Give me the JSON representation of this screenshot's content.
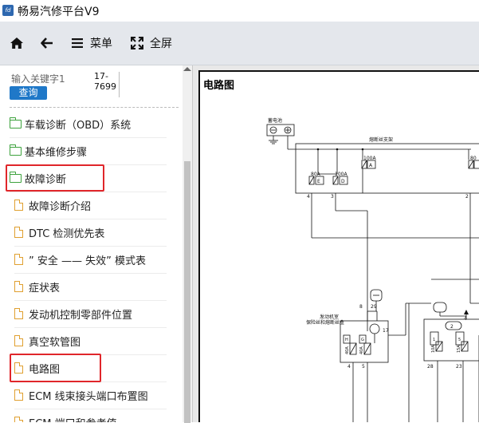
{
  "window": {
    "title": "畅易汽修平台V9",
    "logo_text": "fd"
  },
  "toolbar": {
    "home_label": "",
    "back_label": "",
    "menu_label": "菜单",
    "fullscreen_label": "全屏"
  },
  "search": {
    "placeholder": "输入关键字1",
    "button_label": "查询",
    "code": "17-7699"
  },
  "tree": [
    {
      "label": "车载诊断（OBD）系统",
      "type": "folder"
    },
    {
      "label": "基本维修步骤",
      "type": "folder"
    },
    {
      "label": "故障诊断",
      "type": "folder-open",
      "highlighted": true
    },
    {
      "label": "故障诊断介绍",
      "type": "doc"
    },
    {
      "label": "DTC 检测优先表",
      "type": "doc"
    },
    {
      "label": "” 安全 —— 失效”  模式表",
      "type": "doc"
    },
    {
      "label": "症状表",
      "type": "doc"
    },
    {
      "label": "发动机控制零部件位置",
      "type": "doc"
    },
    {
      "label": "真空软管图",
      "type": "doc"
    },
    {
      "label": "电路图",
      "type": "doc",
      "highlighted": true
    },
    {
      "label": "ECM 线束接头端口布置图",
      "type": "doc"
    },
    {
      "label": "ECM 端口和参考值",
      "type": "doc"
    }
  ],
  "document": {
    "title": "电路图",
    "diagram": {
      "battery": "蓄电池",
      "fuse_box": "熔断丝支架",
      "fuse1_rating": "100A",
      "fuse1_letter": "A",
      "fuse2_rating": "80A",
      "fuse2_letter": "E",
      "fuse3_rating": "100A",
      "fuse3_letter": "D",
      "fuse4_rating": "80",
      "pin_4": "4",
      "pin_3": "3",
      "pin_2": "2",
      "engine_box_line1": "发动机室",
      "engine_box_line2": "保险丝和熔断丝盒",
      "eb_pin_8": "8",
      "eb_pin_29": "29",
      "eb_pin_17": "17",
      "eb_pin_4": "4",
      "eb_pin_5": "5",
      "eb_fuse1": "40A",
      "eb_fuse1_tag": "H",
      "eb_fuse2": "40A",
      "eb_fuse2_tag": "G",
      "r_pin_4": "4",
      "r_pin_28": "28",
      "r_pin_23": "23",
      "r_fuse1": "10A",
      "r_fuse1_tag": "1",
      "r_fuse2": "15A",
      "r_fuse2_tag": "5",
      "r_num_2": "2"
    }
  },
  "colors": {
    "accent": "#1f78c8",
    "highlight": "#e0262a",
    "folder": "#3da23d",
    "doc": "#e0a030",
    "toolbar_bg": "#e4e7ec"
  }
}
